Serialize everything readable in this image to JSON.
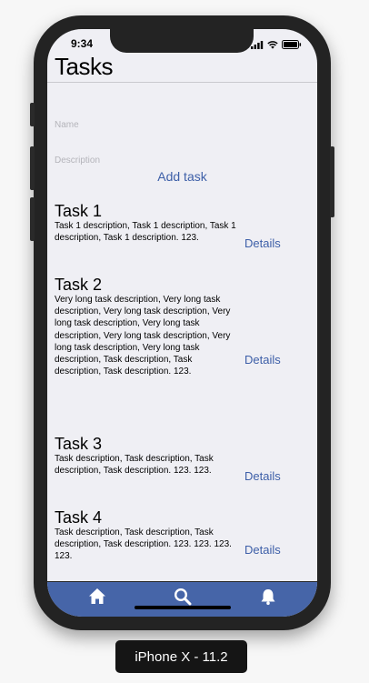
{
  "status_bar": {
    "time": "9:34"
  },
  "header": {
    "title": "Tasks"
  },
  "form": {
    "name_placeholder": "Name",
    "description_placeholder": "Description",
    "add_task_label": "Add task"
  },
  "tasks": [
    {
      "name": "Task 1",
      "description": "Task 1 description, Task 1 description, Task 1 description, Task 1 description. 123.",
      "details_label": "Details"
    },
    {
      "name": "Task 2",
      "description": "Very long task description, Very long task description, Very long task description, Very long task description, Very long task description, Very long task description, Very long task description, Very long task description, Task description, Task description, Task description. 123.",
      "details_label": "Details"
    },
    {
      "name": "Task 3",
      "description": "Task description, Task description, Task description, Task description. 123. 123.",
      "details_label": "Details"
    },
    {
      "name": "Task 4",
      "description": "Task description, Task description, Task description, Task description. 123. 123. 123. 123.",
      "details_label": "Details"
    }
  ],
  "tab_bar": {
    "icons": [
      "home-icon",
      "search-icon",
      "bell-icon"
    ]
  },
  "device_label": "iPhone X - 11.2",
  "colors": {
    "accent": "#3d5fa8",
    "tab_bar": "#4665a8",
    "background": "#efeff4"
  }
}
